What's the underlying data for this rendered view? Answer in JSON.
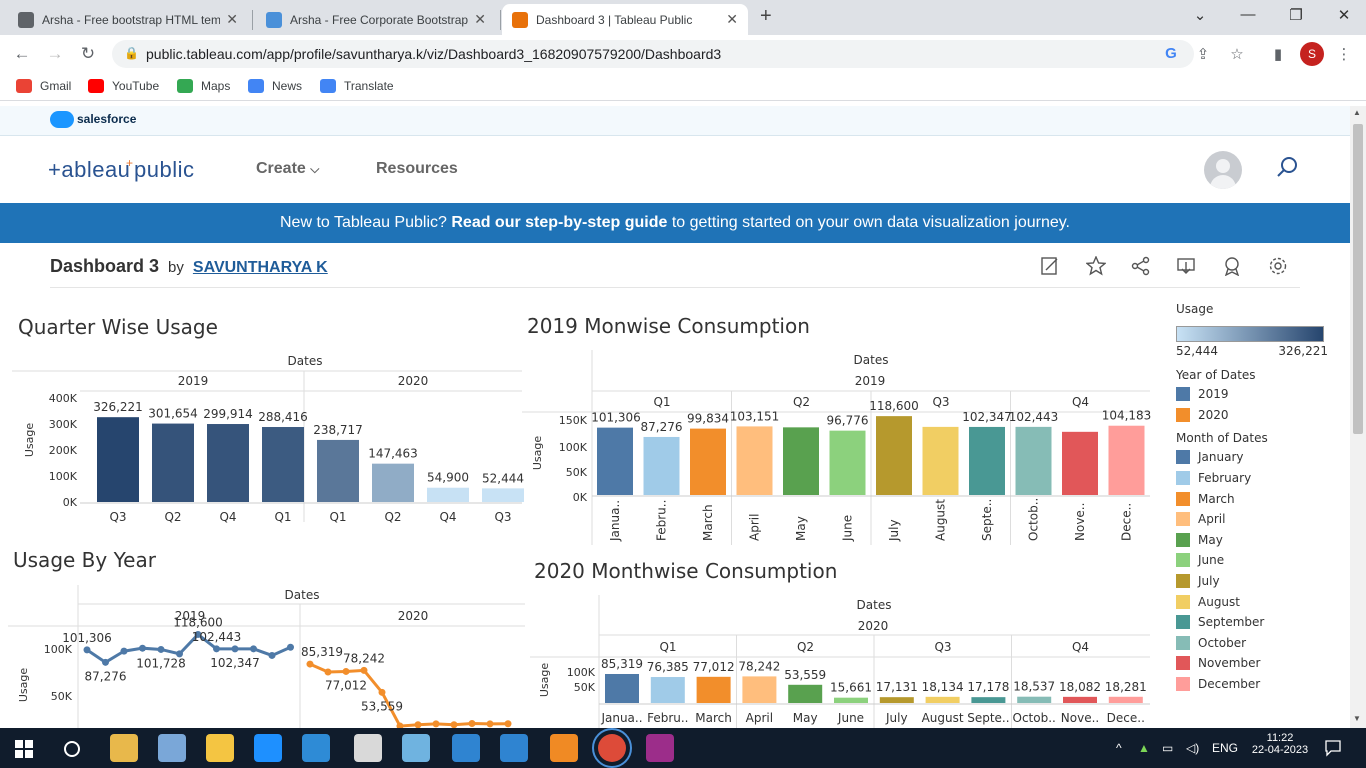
{
  "browser": {
    "tabs": [
      {
        "title": "Arsha - Free bootstrap HTML tem",
        "active": false,
        "color": "#5f6368"
      },
      {
        "title": "Arsha - Free Corporate Bootstrap",
        "active": false,
        "color": "#4a90d9"
      },
      {
        "title": "Dashboard 3 | Tableau Public",
        "active": true,
        "color": "#e8710a"
      }
    ],
    "url": "public.tableau.com/app/profile/savuntharya.k/viz/Dashboard3_16820907579200/Dashboard3",
    "profile_initial": "S",
    "bookmarks": [
      {
        "label": "Gmail",
        "color": "#ea4335"
      },
      {
        "label": "YouTube",
        "color": "#ff0000"
      },
      {
        "label": "Maps",
        "color": "#34a853"
      },
      {
        "label": "News",
        "color": "#4285f4"
      },
      {
        "label": "Translate",
        "color": "#4285f4"
      }
    ]
  },
  "site": {
    "salesforce": "salesforce",
    "logo": "+ab|eau+public",
    "nav": [
      "Create",
      "Resources"
    ],
    "banner_prefix": "New to Tableau Public? ",
    "banner_bold": "Read our step-by-step guide",
    "banner_suffix": " to getting started on your own data visualization journey.",
    "viz_title": "Dashboard 3",
    "by": "by",
    "author": "SAVUNTHARYA K"
  },
  "chart_data": [
    {
      "type": "bar",
      "title": "Quarter Wise Usage",
      "header": "Dates",
      "groups": [
        "2019",
        "2020"
      ],
      "categories": [
        "Q3",
        "Q2",
        "Q4",
        "Q1",
        "Q1",
        "Q2",
        "Q4",
        "Q3"
      ],
      "values": [
        326221,
        301654,
        299914,
        288416,
        238717,
        147463,
        54900,
        52444
      ],
      "labels": [
        "326,221",
        "301,654",
        "299,914",
        "288,416",
        "238,717",
        "147,463",
        "54,900",
        "52,444"
      ],
      "ylabel": "Usage",
      "yticks": [
        "400K",
        "300K",
        "200K",
        "100K",
        "0K"
      ],
      "ylim": [
        0,
        400000
      ]
    },
    {
      "type": "bar",
      "title": "2019 Monwise Consumption",
      "header": "Dates",
      "year": "2019",
      "quarters": [
        "Q1",
        "Q2",
        "Q3",
        "Q4"
      ],
      "categories": [
        "Janua..",
        "Febru..",
        "March",
        "April",
        "May",
        "June",
        "July",
        "August",
        "Septe..",
        "Octob..",
        "Nove..",
        "Dece.."
      ],
      "values": [
        101306,
        87276,
        99834,
        103151,
        101728,
        96776,
        118600,
        102443,
        102347,
        102443,
        95000,
        104183
      ],
      "labels": [
        "101,306",
        "87,276",
        "99,834",
        "103,151",
        "",
        "96,776",
        "118,600",
        "",
        "102,347",
        "102,443",
        "",
        "104,183"
      ],
      "ylabel": "Usage",
      "yticks": [
        "150K",
        "100K",
        "50K",
        "0K"
      ],
      "ylim": [
        0,
        150000
      ]
    },
    {
      "type": "line",
      "title": "Usage By Year",
      "header": "Dates",
      "groups": [
        "2019",
        "2020"
      ],
      "series": [
        {
          "name": "2019",
          "values": [
            101306,
            87276,
            99834,
            103151,
            101728,
            96776,
            118600,
            102443,
            102347,
            102443,
            95000,
            104183
          ],
          "labels": [
            "101,306",
            "87,276",
            "",
            "",
            "101,728",
            "",
            "118,600",
            "102,443",
            "102,347",
            "",
            "",
            ""
          ]
        },
        {
          "name": "2020",
          "values": [
            85319,
            76385,
            77012,
            78242,
            53559,
            15661,
            17131,
            18134,
            17178,
            18537,
            18082,
            18281
          ],
          "labels": [
            "85,319",
            "",
            "77,012",
            "78,242",
            "53,559",
            "",
            "17,131",
            "",
            "",
            "18,537",
            "",
            ""
          ]
        }
      ],
      "ylabel": "Usage",
      "yticks": [
        "100K",
        "50K"
      ]
    },
    {
      "type": "bar",
      "title": "2020 Monthwise Consumption",
      "header": "Dates",
      "year": "2020",
      "quarters": [
        "Q1",
        "Q2",
        "Q3",
        "Q4"
      ],
      "categories": [
        "Janua..",
        "Febru..",
        "March",
        "April",
        "May",
        "June",
        "July",
        "August",
        "Septe..",
        "Octob..",
        "Nove..",
        "Dece.."
      ],
      "values": [
        85319,
        76385,
        77012,
        78242,
        53559,
        15661,
        17131,
        18134,
        17178,
        18537,
        18082,
        18281
      ],
      "labels": [
        "85,319",
        "76,385",
        "77,012",
        "78,242",
        "53,559",
        "15,661",
        "17,131",
        "18,134",
        "17,178",
        "18,537",
        "18,082",
        "18,281"
      ],
      "ylabel": "Usage",
      "yticks": [
        "100K",
        "50K"
      ]
    }
  ],
  "legend": {
    "usage_title": "Usage",
    "usage_min": "52,444",
    "usage_max": "326,221",
    "year_title": "Year of Dates",
    "years": [
      {
        "label": "2019",
        "color": "#4e79a7"
      },
      {
        "label": "2020",
        "color": "#f28e2b"
      }
    ],
    "month_title": "Month of Dates",
    "months": [
      {
        "label": "January",
        "color": "#4e79a7"
      },
      {
        "label": "February",
        "color": "#a0cbe8"
      },
      {
        "label": "March",
        "color": "#f28e2b"
      },
      {
        "label": "April",
        "color": "#ffbe7d"
      },
      {
        "label": "May",
        "color": "#59a14f"
      },
      {
        "label": "June",
        "color": "#8cd17d"
      },
      {
        "label": "July",
        "color": "#b6992d"
      },
      {
        "label": "August",
        "color": "#f1ce63"
      },
      {
        "label": "September",
        "color": "#499894"
      },
      {
        "label": "October",
        "color": "#86bcb6"
      },
      {
        "label": "November",
        "color": "#e15759"
      },
      {
        "label": "December",
        "color": "#ff9d9a"
      }
    ]
  },
  "taskbar": {
    "lang": "ENG",
    "time": "11:22",
    "date": "22-04-2023"
  }
}
